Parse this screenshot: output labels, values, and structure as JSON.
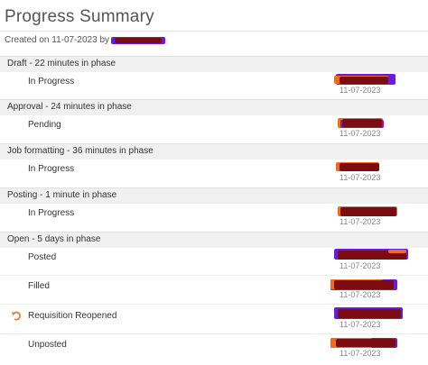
{
  "page": {
    "title": "Progress Summary",
    "created_label": "Created on 11-07-2023 by"
  },
  "colors": {
    "phase_bg": "#f0f0f0",
    "redact_orange": "#f26a1b",
    "redact_purple": "#6a1be0",
    "redact_dark": "#7a0c12",
    "reopen_icon": "#e8802a"
  },
  "phases": [
    {
      "label": "Draft - 22 minutes in phase",
      "entries": [
        {
          "status": "In Progress",
          "date": "11-07-2023"
        }
      ]
    },
    {
      "label": "Approval - 24 minutes in phase",
      "entries": [
        {
          "status": "Pending",
          "date": "11-07-2023"
        }
      ]
    },
    {
      "label": "Job formatting - 36 minutes in phase",
      "entries": [
        {
          "status": "In Progress",
          "date": "11-07-2023"
        }
      ]
    },
    {
      "label": "Posting - 1 minute in phase",
      "entries": [
        {
          "status": "In Progress",
          "date": "11-07-2023"
        }
      ]
    },
    {
      "label": "Open - 5 days in phase",
      "entries": [
        {
          "status": "Posted",
          "date": "11-07-2023"
        },
        {
          "status": "Filled",
          "date": "11-07-2023"
        },
        {
          "status": "Requisition Reopened",
          "date": "11-07-2023",
          "icon": "undo-arrow-icon"
        },
        {
          "status": "Unposted",
          "date": "11-07-2023"
        }
      ]
    }
  ]
}
